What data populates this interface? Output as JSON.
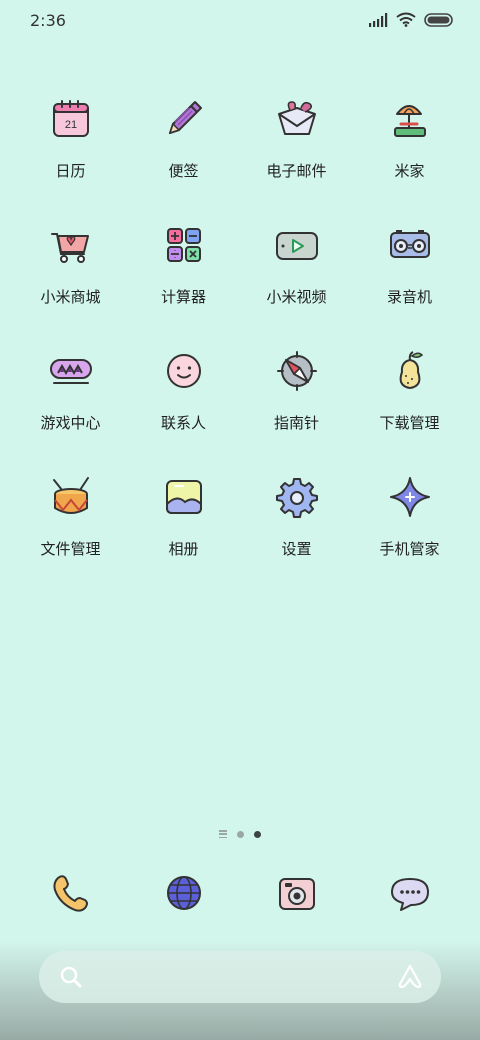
{
  "status_bar": {
    "time": "2:36"
  },
  "apps": [
    {
      "label": "日历",
      "icon": "calendar-icon",
      "day": "21"
    },
    {
      "label": "便签",
      "icon": "notes-icon"
    },
    {
      "label": "电子邮件",
      "icon": "email-icon"
    },
    {
      "label": "米家",
      "icon": "mijia-icon"
    },
    {
      "label": "小米商城",
      "icon": "mall-icon"
    },
    {
      "label": "计算器",
      "icon": "calculator-icon"
    },
    {
      "label": "小米视频",
      "icon": "video-icon"
    },
    {
      "label": "录音机",
      "icon": "recorder-icon"
    },
    {
      "label": "游戏中心",
      "icon": "game-center-icon"
    },
    {
      "label": "联系人",
      "icon": "contacts-icon"
    },
    {
      "label": "指南针",
      "icon": "compass-icon"
    },
    {
      "label": "下载管理",
      "icon": "downloads-icon"
    },
    {
      "label": "文件管理",
      "icon": "files-icon"
    },
    {
      "label": "相册",
      "icon": "gallery-icon"
    },
    {
      "label": "设置",
      "icon": "settings-icon"
    },
    {
      "label": "手机管家",
      "icon": "security-icon"
    }
  ],
  "dock": [
    {
      "icon": "phone-icon"
    },
    {
      "icon": "browser-icon"
    },
    {
      "icon": "camera-icon"
    },
    {
      "icon": "messages-icon"
    }
  ],
  "pager": {
    "pages": 2,
    "current": 2
  },
  "colors": {
    "background": "#d3f6ec",
    "outline": "#333333"
  }
}
